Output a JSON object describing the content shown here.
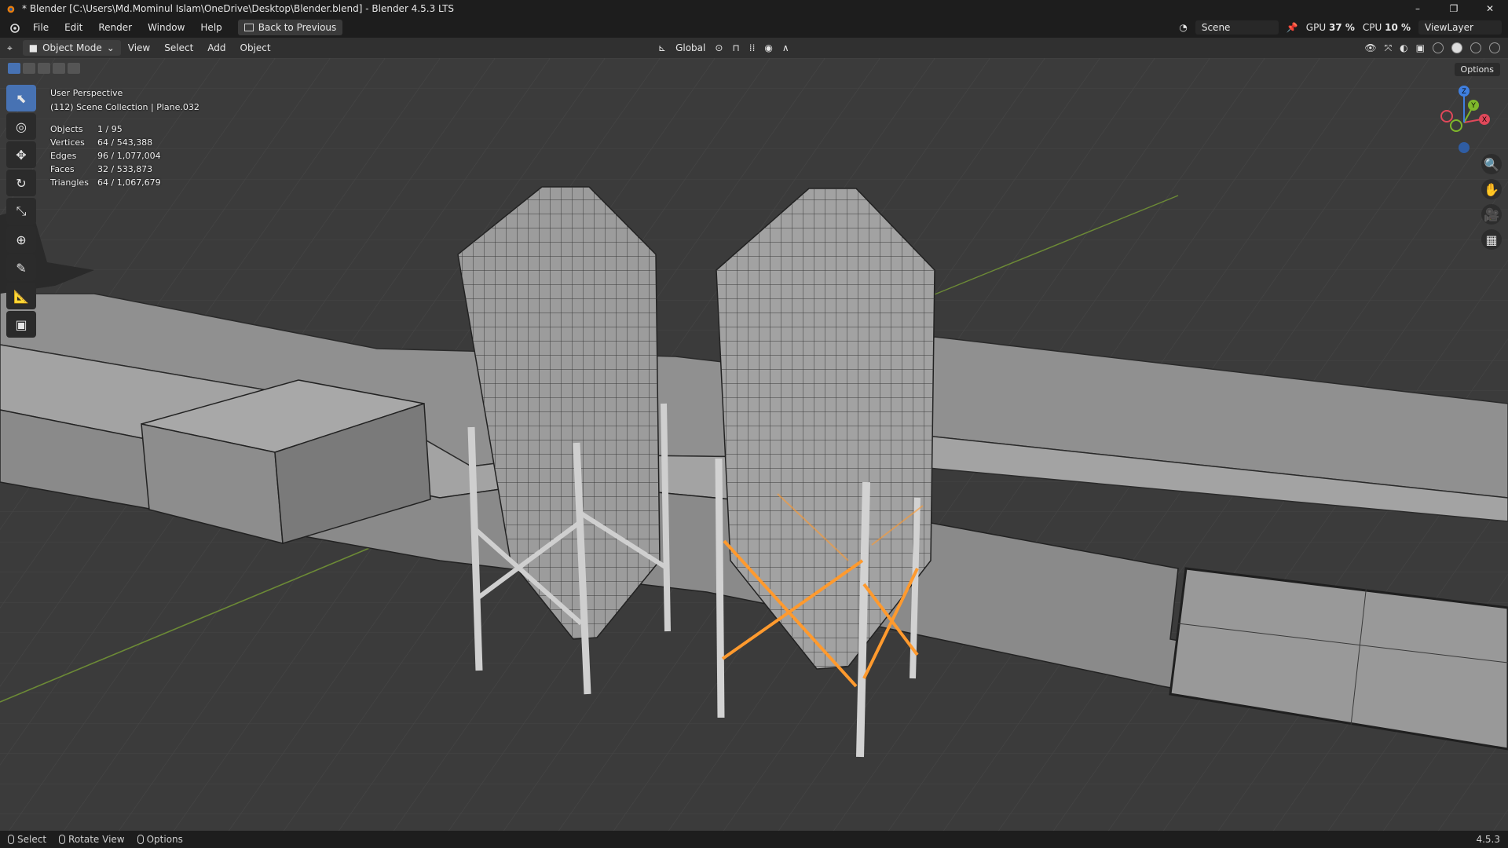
{
  "titlebar": {
    "title": "* Blender [C:\\Users\\Md.Mominul Islam\\OneDrive\\Desktop\\Blender.blend] - Blender 4.5.3 LTS",
    "minimize": "–",
    "maximize": "❐",
    "close": "✕"
  },
  "menubar": {
    "items": [
      "File",
      "Edit",
      "Render",
      "Window",
      "Help"
    ],
    "back_button": "Back to Previous",
    "scene": "Scene",
    "view_layer": "ViewLayer",
    "gpu_label": "GPU",
    "gpu_value": "37 %",
    "cpu_label": "CPU",
    "cpu_value": "10 %"
  },
  "header": {
    "mode": "Object Mode",
    "menus": [
      "View",
      "Select",
      "Add",
      "Object"
    ],
    "transform_orientation": "Global"
  },
  "viewport": {
    "perspective": "User Perspective",
    "collection": "(112) Scene Collection | Plane.032",
    "options": "Options",
    "stats": [
      {
        "label": "Objects",
        "value": "1 / 95"
      },
      {
        "label": "Vertices",
        "value": "64 / 543,388"
      },
      {
        "label": "Edges",
        "value": "96 / 1,077,004"
      },
      {
        "label": "Faces",
        "value": "32 / 533,873"
      },
      {
        "label": "Triangles",
        "value": "64 / 1,067,679"
      }
    ],
    "gizmo": {
      "x": "X",
      "y": "Y",
      "z": "Z"
    }
  },
  "statusbar": {
    "select": "Select",
    "rotate": "Rotate View",
    "options": "Options",
    "version": "4.5.3"
  },
  "colors": {
    "selection": "#ff9a2e",
    "axis_x": "#e0485a",
    "axis_y": "#7fb82b",
    "axis_z": "#3f7fe0",
    "accent": "#4772b3"
  }
}
